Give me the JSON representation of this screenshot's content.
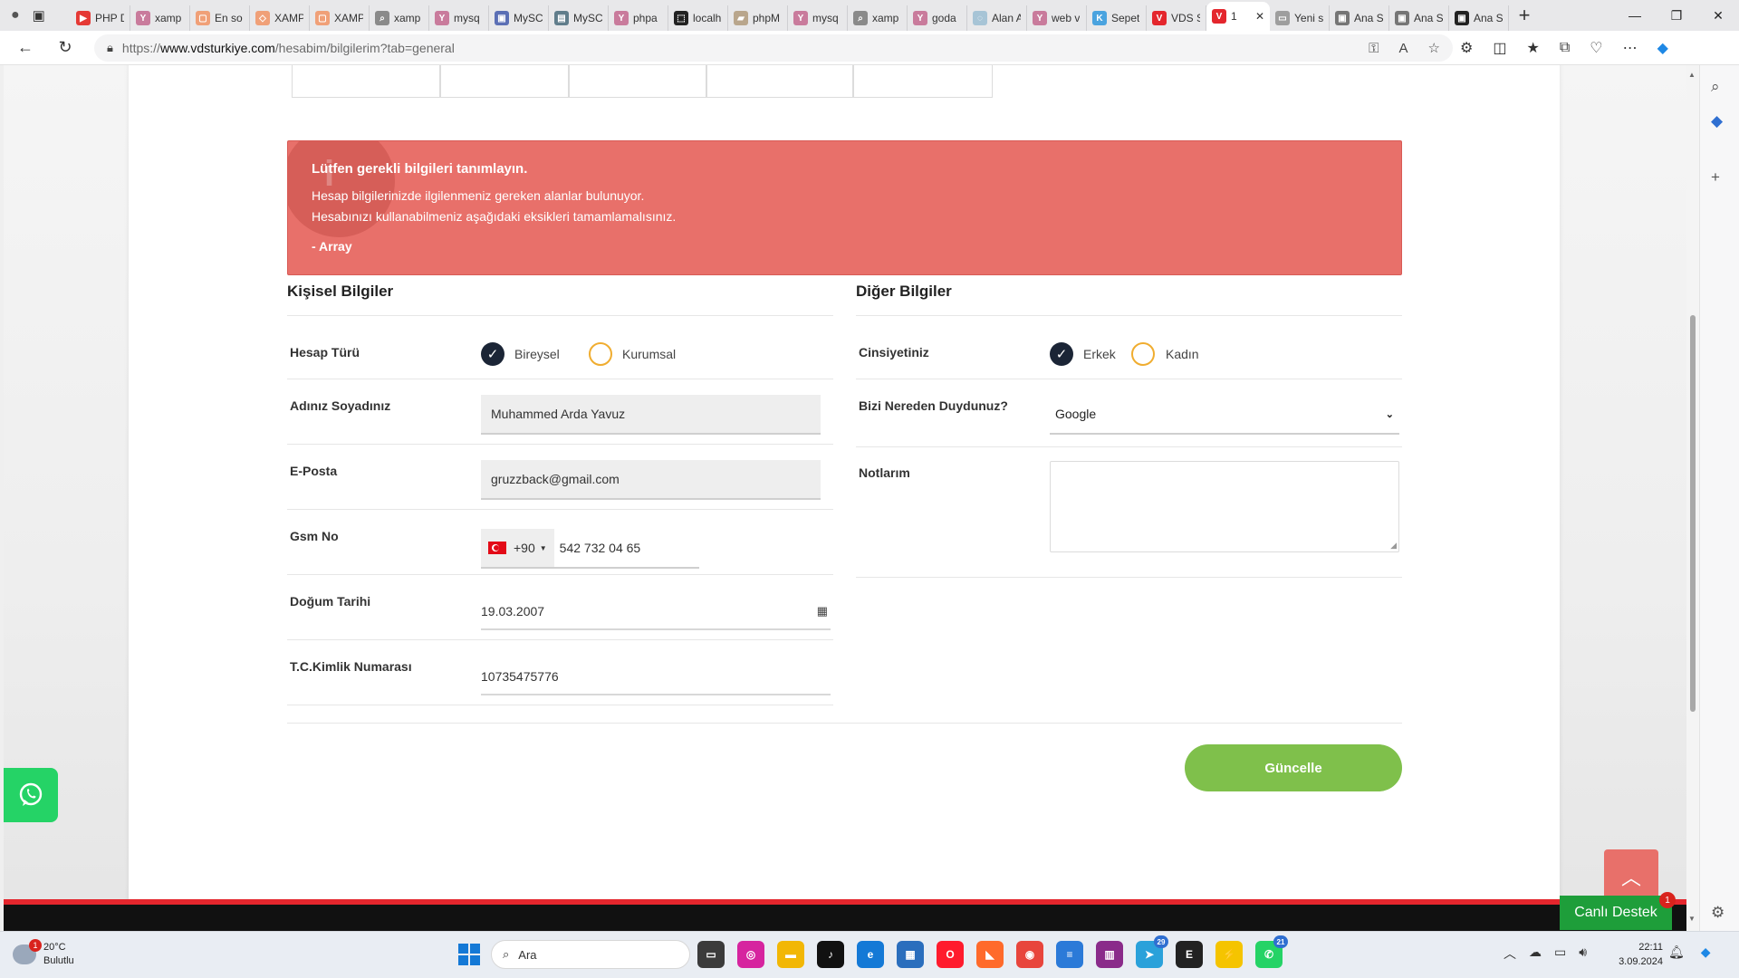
{
  "browser": {
    "tabs": [
      {
        "title": "PHP D",
        "fav_color": "#e53935",
        "fav_char": "▶"
      },
      {
        "title": "xamp",
        "fav_color": "#c97b9c",
        "fav_char": "Y"
      },
      {
        "title": "En so",
        "fav_color": "#f0a078",
        "fav_char": "▢"
      },
      {
        "title": "XAMP",
        "fav_color": "#f0a078",
        "fav_char": "◇"
      },
      {
        "title": "XAMP",
        "fav_color": "#f0a078",
        "fav_char": "▢"
      },
      {
        "title": "xamp",
        "fav_color": "#8a8a8a",
        "fav_char": "⌕"
      },
      {
        "title": "mysq",
        "fav_color": "#c97b9c",
        "fav_char": "Y"
      },
      {
        "title": "MySC",
        "fav_color": "#5b6fb5",
        "fav_char": "▣"
      },
      {
        "title": "MySC",
        "fav_color": "#607d8b",
        "fav_char": "▤"
      },
      {
        "title": "phpa",
        "fav_color": "#c97b9c",
        "fav_char": "Y"
      },
      {
        "title": "localh",
        "fav_color": "#222222",
        "fav_char": "⬚"
      },
      {
        "title": "phpM",
        "fav_color": "#b9a68c",
        "fav_char": "▰"
      },
      {
        "title": "mysq",
        "fav_color": "#c97b9c",
        "fav_char": "Y"
      },
      {
        "title": "xamp",
        "fav_color": "#8a8a8a",
        "fav_char": "⌕"
      },
      {
        "title": "goda",
        "fav_color": "#c97b9c",
        "fav_char": "Y"
      },
      {
        "title": "Alan A",
        "fav_color": "#a7c4d6",
        "fav_char": "◌"
      },
      {
        "title": "web v",
        "fav_color": "#c97b9c",
        "fav_char": "Y"
      },
      {
        "title": "Sepet",
        "fav_color": "#4aa3df",
        "fav_char": "K"
      },
      {
        "title": "VDS S",
        "fav_color": "#e4262d",
        "fav_char": "V"
      },
      {
        "title": "1",
        "fav_color": "#e4262d",
        "fav_char": "V",
        "active": true
      },
      {
        "title": "Yeni s",
        "fav_color": "#9e9e9e",
        "fav_char": "▭"
      },
      {
        "title": "Ana S",
        "fav_color": "#757575",
        "fav_char": "▣"
      },
      {
        "title": "Ana S",
        "fav_color": "#757575",
        "fav_char": "▣"
      },
      {
        "title": "Ana S",
        "fav_color": "#222222",
        "fav_char": "▣"
      }
    ],
    "url": {
      "scheme": "https://",
      "host": "www.vdsturkiye.com",
      "path": "/hesabim/bilgilerim?tab=general"
    }
  },
  "alert": {
    "title": "Lütfen gerekli bilgileri tanımlayın.",
    "line1": "Hesap bilgilerinizde ilgilenmeniz gereken alanlar bulunuyor.",
    "line2": "Hesabınızı kullanabilmeniz aşağıdaki eksikleri tamamlamalısınız.",
    "footer": "- Array"
  },
  "personal": {
    "section_title": "Kişisel Bilgiler",
    "account_type_label": "Hesap Türü",
    "account_type_options": [
      "Bireysel",
      "Kurumsal"
    ],
    "account_type_selected": "Bireysel",
    "name_label": "Adınız Soyadınız",
    "name_value": "Muhammed Arda Yavuz",
    "email_label": "E-Posta",
    "email_value": "gruzzback@gmail.com",
    "gsm_label": "Gsm No",
    "gsm_country_code": "+90",
    "gsm_value": "542 732 04 65",
    "birth_label": "Doğum Tarihi",
    "birth_value": "19.03.2007",
    "tc_label": "T.C.Kimlik Numarası",
    "tc_value": "10735475776"
  },
  "other": {
    "section_title": "Diğer Bilgiler",
    "gender_label": "Cinsiyetiniz",
    "gender_options": [
      "Erkek",
      "Kadın"
    ],
    "gender_selected": "Erkek",
    "source_label": "Bizi Nereden Duydunuz?",
    "source_value": "Google",
    "notes_label": "Notlarım",
    "notes_value": ""
  },
  "buttons": {
    "update": "Güncelle"
  },
  "widgets": {
    "live_support": "Canlı Destek",
    "live_support_badge": "1"
  },
  "taskbar": {
    "weather_temp": "20°C",
    "weather_desc": "Bulutlu",
    "weather_badge": "1",
    "search_placeholder": "Ara",
    "time": "22:11",
    "date": "3.09.2024",
    "telegram_badge": "29",
    "whatsapp_badge": "21"
  },
  "colors": {
    "alert_bg": "#e8706a",
    "update_btn": "#7fc04b",
    "radio_checked": "#1b2536",
    "radio_empty_border": "#f0ad30",
    "footer_red": "#e4262d",
    "live_support": "#1e9e3a",
    "whatsapp": "#25d366"
  }
}
